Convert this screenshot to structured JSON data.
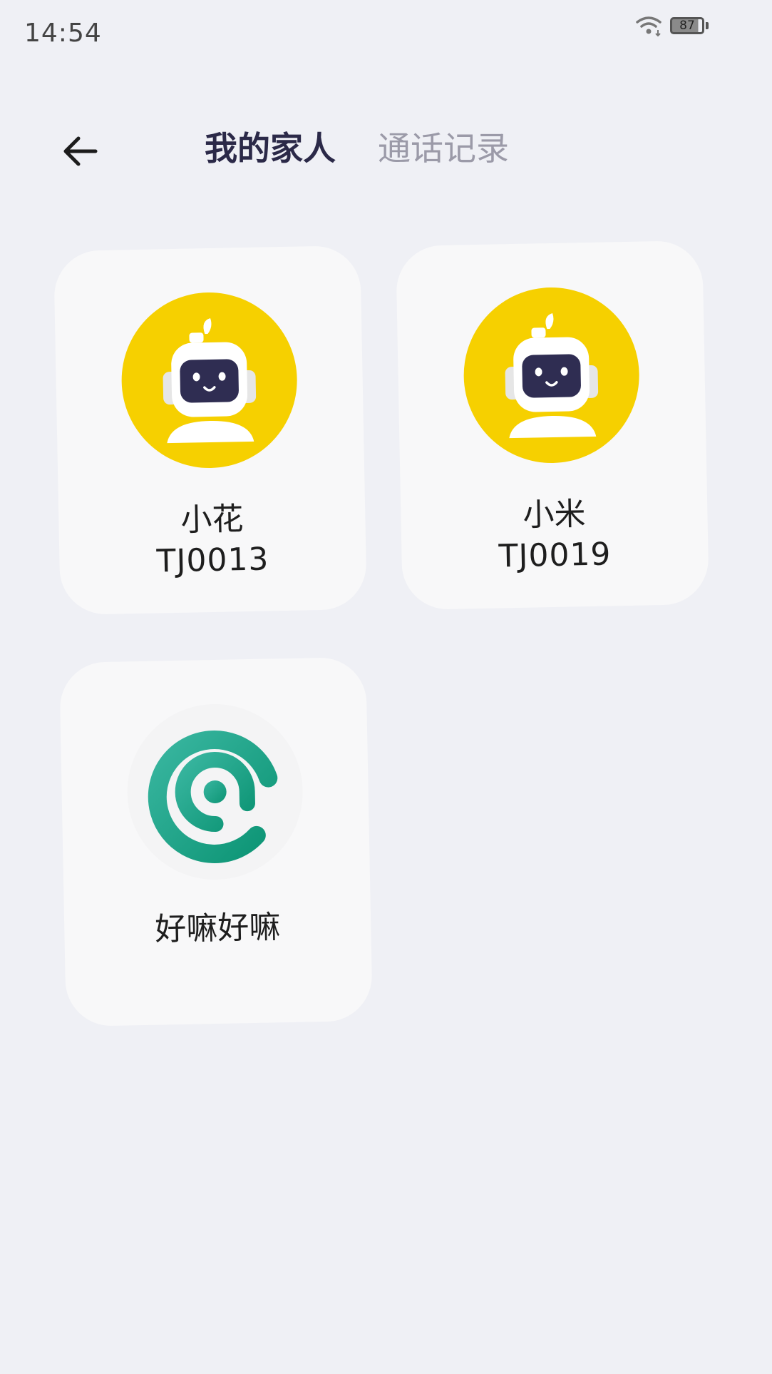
{
  "status_bar": {
    "time": "14:54",
    "battery_level": "87",
    "wifi_icon": "wifi-icon",
    "battery_icon": "battery-icon"
  },
  "header": {
    "back_icon": "arrow-left-icon",
    "tabs": [
      {
        "label": "我的家人",
        "active": true
      },
      {
        "label": "通话记录",
        "active": false
      }
    ]
  },
  "contacts": [
    {
      "name": "小花",
      "id": "TJ0013",
      "avatar": "robot-avatar-icon"
    },
    {
      "name": "小米",
      "id": "TJ0019",
      "avatar": "robot-avatar-icon"
    },
    {
      "name": "好嘛好嘛",
      "id": "",
      "avatar": "app-logo-icon"
    }
  ],
  "colors": {
    "background": "#eff0f5",
    "card": "#f8f8f9",
    "active_tab": "#2b2948",
    "inactive_tab": "#9b9aa8",
    "robot_bg": "#f6d000",
    "robot_face": "#2f2d52",
    "logo_green": "#1aa68a"
  }
}
